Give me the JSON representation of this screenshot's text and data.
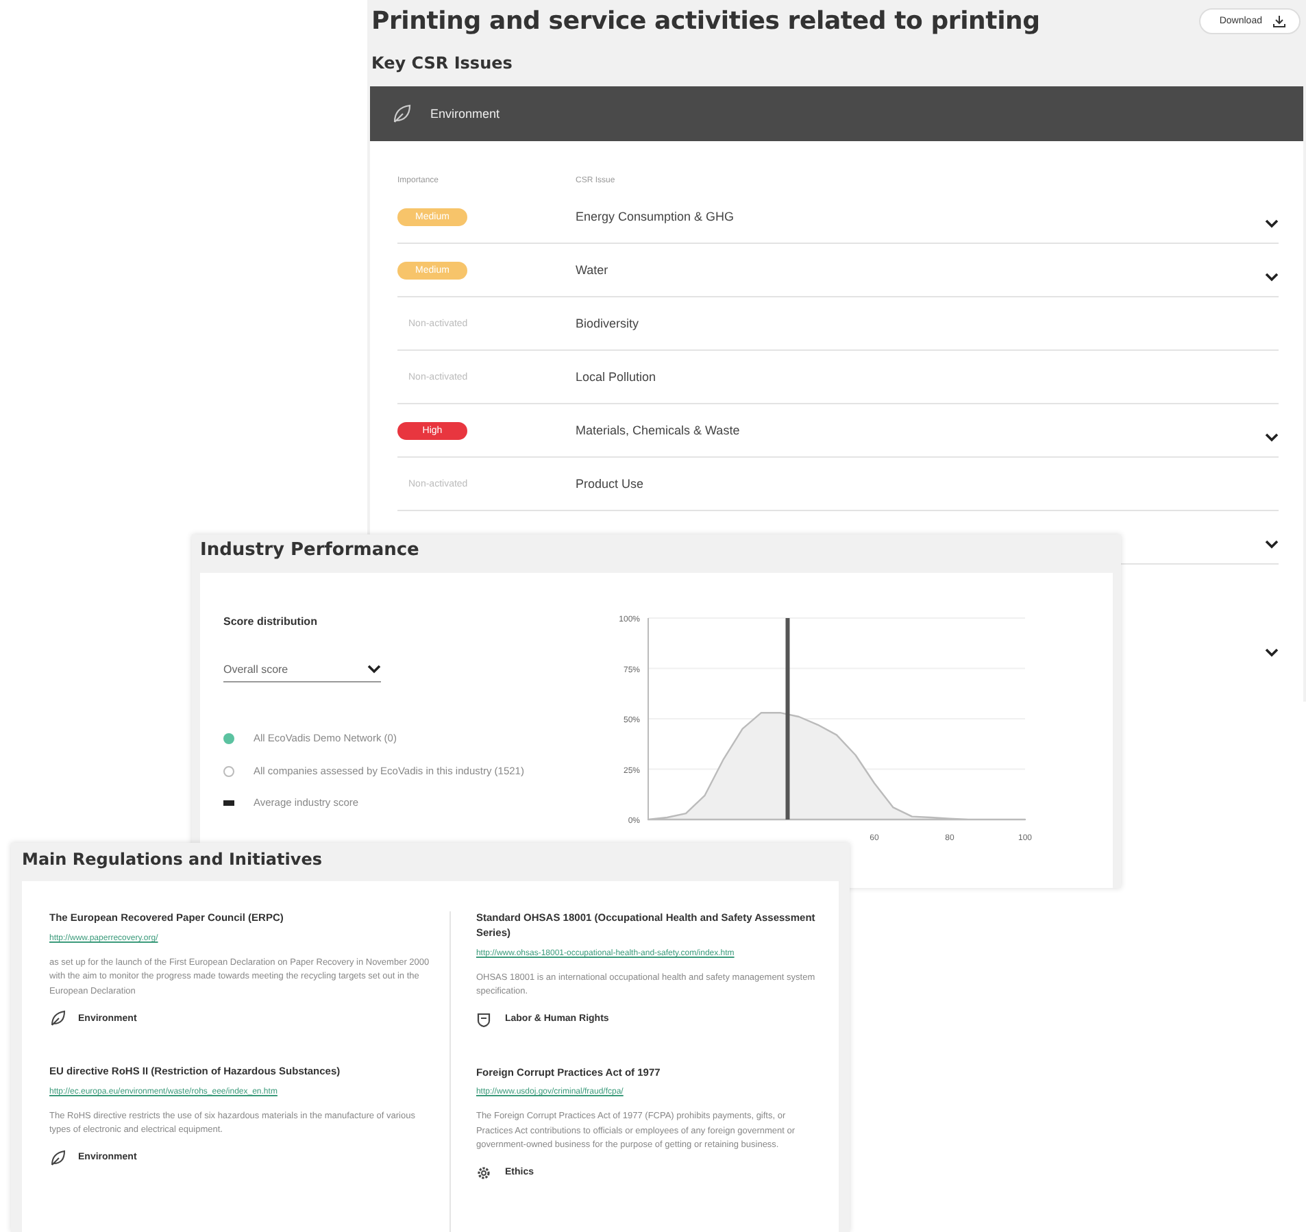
{
  "report": {
    "title": "Printing and service activities related to printing",
    "download_button": "Download",
    "section_title": "Key CSR Issues",
    "theme": "Environment",
    "columns": [
      "Importance",
      "CSR Issue"
    ],
    "issues": [
      {
        "importance": "Medium",
        "kind": "medium",
        "issue": "Energy Consumption & GHG",
        "expandable": true
      },
      {
        "importance": "Medium",
        "kind": "medium",
        "issue": "Water",
        "expandable": true
      },
      {
        "importance": "Non-activated",
        "kind": "inactive",
        "issue": "Biodiversity",
        "expandable": false
      },
      {
        "importance": "Non-activated",
        "kind": "inactive",
        "issue": "Local Pollution",
        "expandable": false
      },
      {
        "importance": "High",
        "kind": "high",
        "issue": "Materials, Chemicals & Waste",
        "expandable": true
      },
      {
        "importance": "Non-activated",
        "kind": "inactive",
        "issue": "Product Use",
        "expandable": false
      },
      {
        "expandable": true
      },
      {
        "expandable": true
      }
    ]
  },
  "industry_performance": {
    "title": "Industry Performance",
    "subtitle": "Score distribution",
    "dropdown": {
      "value": "Overall score"
    },
    "legend": [
      {
        "label": "All EcoVadis Demo Network (0)",
        "kind": "filled"
      },
      {
        "label": "All companies assessed by EcoVadis in this industry (1521)",
        "kind": "hollow"
      },
      {
        "label": "Average industry score",
        "kind": "bar"
      }
    ],
    "chart_data": {
      "type": "area",
      "x": [
        0,
        5,
        10,
        15,
        20,
        25,
        30,
        35,
        40,
        45,
        50,
        55,
        60,
        65,
        70,
        75,
        80,
        85,
        90,
        95,
        100
      ],
      "series": [
        {
          "color": "#bbbbbb",
          "values": [
            0,
            1,
            3,
            12,
            30,
            45,
            53,
            53,
            51,
            47,
            42,
            32,
            18,
            6,
            1.5,
            1,
            0.5,
            0,
            0,
            0,
            0
          ]
        }
      ],
      "xlim": [
        0,
        100
      ],
      "ylim": [
        0,
        100
      ],
      "xticks": [
        60,
        80,
        100
      ],
      "yticks": [
        {
          "value": 0,
          "label": "0%"
        },
        {
          "value": 25,
          "label": "25%"
        },
        {
          "value": 50,
          "label": "50%"
        },
        {
          "value": 75,
          "label": "75%"
        },
        {
          "value": 100,
          "label": "100%"
        }
      ],
      "grid": true,
      "ref_lines": [
        {
          "axis": "x",
          "value": 37
        }
      ]
    }
  },
  "regulations": {
    "title": "Main Regulations and Initiatives",
    "columns": [
      [
        {
          "title": "The European Recovered Paper Council (ERPC)",
          "link": "http://www.paperrecovery.org/",
          "description": "as set up for the launch of the First European Declaration on Paper Recovery in November 2000 with the aim to monitor the progress made towards meeting the recycling targets set out in the European Declaration",
          "category": "Environment",
          "kind": "environment"
        },
        {
          "title": "EU directive RoHS II (Restriction of Hazardous Substances)",
          "link": "http://ec.europa.eu/environment/waste/rohs_eee/index_en.htm",
          "description": "The RoHS directive restricts the use of six hazardous materials in the manufacture of various types of electronic and electrical equipment.",
          "category": "Environment",
          "kind": "environment"
        }
      ],
      [
        {
          "title": "Standard OHSAS 18001 (Occupational Health and Safety Assessment Series)",
          "link": "http://www.ohsas-18001-occupational-health-and-safety.com/index.htm",
          "description": "OHSAS 18001 is an international occupational health and safety management system specification.",
          "category": "Labor & Human Rights",
          "kind": "labor"
        },
        {
          "title": "Foreign Corrupt Practices Act of 1977",
          "link": "http://www.usdoj.gov/criminal/fraud/fcpa/",
          "description": "The Foreign Corrupt Practices Act of 1977 (FCPA) prohibits payments, gifts, or Practices Act contributions to officials or employees of any foreign government or government-owned business for the purpose of getting or retaining business.",
          "category": "Ethics",
          "kind": "ethics"
        }
      ]
    ]
  }
}
